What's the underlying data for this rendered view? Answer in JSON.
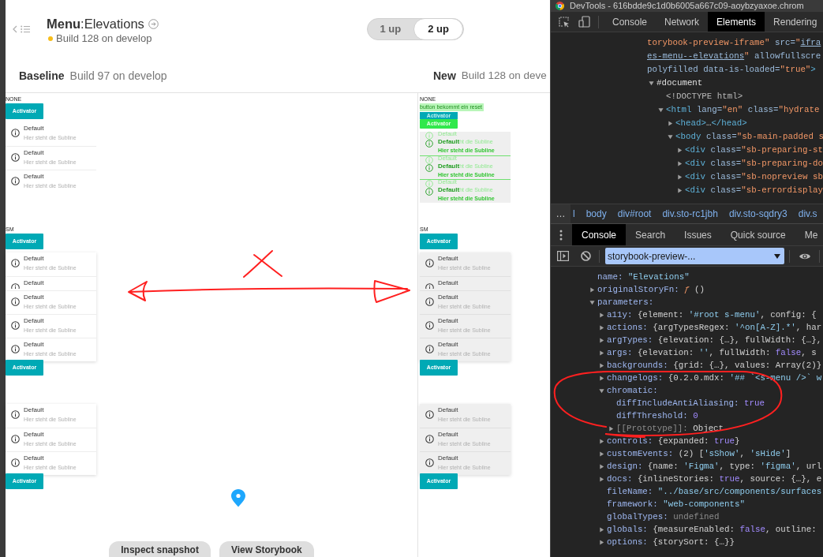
{
  "app": {
    "header": {
      "title": "**Menu**:Elevations",
      "build": "Build 128 on develop"
    },
    "view_toggle": [
      {
        "label": "1 up",
        "selected": false
      },
      {
        "label": "2 up",
        "selected": true
      }
    ],
    "panels": [
      {
        "label": "Baseline",
        "build": "Build 97 on develop",
        "stories": [
          {
            "label": "NONE",
            "blocks": [
              {
                "kind": "activator",
                "text": "Activator",
                "diff": false
              },
              {
                "kind": "menu",
                "raised": false,
                "filled": false,
                "items": [
                  {
                    "title": "Default",
                    "subline": "Hier steht die Subline",
                    "overlapped": false,
                    "diff": false
                  },
                  {
                    "title": "Default",
                    "subline": "Hier steht die Subline",
                    "overlapped": false,
                    "diff": false
                  },
                  {
                    "title": "Default",
                    "subline": "Hier steht die Subline",
                    "overlapped": false,
                    "diff": false
                  }
                ]
              }
            ]
          },
          {
            "label": "SM",
            "blocks": [
              {
                "kind": "activator",
                "text": "Activator",
                "diff": false
              },
              {
                "kind": "menu",
                "raised": true,
                "filled": false,
                "items": [
                  {
                    "title": "Default",
                    "subline": "Hier steht die Subline",
                    "overlapped": false,
                    "diff": false
                  },
                  {
                    "title": "Default",
                    "overlapped": true,
                    "diff": false
                  },
                  {
                    "title": "Default",
                    "subline": "Hier steht die Subline",
                    "overlapped": false,
                    "diff": false
                  },
                  {
                    "title": "Default",
                    "subline": "Hier steht die Subline",
                    "overlapped": false,
                    "diff": false
                  },
                  {
                    "title": "Default",
                    "subline": "Hier steht die Subline",
                    "overlapped": false,
                    "diff": false
                  }
                ]
              },
              {
                "kind": "activator",
                "text": "Activator",
                "diff": false
              }
            ]
          },
          {
            "blocks": [
              {
                "kind": "menu",
                "raised": true,
                "filled": false,
                "items": [
                  {
                    "title": "Default",
                    "subline": "Hier steht die Subline",
                    "overlapped": false,
                    "diff": false
                  },
                  {
                    "title": "Default",
                    "subline": "Hier steht die Subline",
                    "overlapped": false,
                    "diff": false
                  },
                  {
                    "title": "Default",
                    "subline": "Hier steht die Subline",
                    "overlapped": false,
                    "diff": false
                  }
                ]
              },
              {
                "kind": "activator",
                "text": "Activator",
                "diff": false
              }
            ]
          }
        ]
      },
      {
        "label": "New",
        "build": "Build 128 on deve",
        "stories": [
          {
            "label": "NONE",
            "blocks": [
              {
                "kind": "note",
                "text": "button bekommt ein reset"
              },
              {
                "kind": "activator",
                "text": "Activator",
                "diff": true,
                "ghost_text": "Activator"
              },
              {
                "kind": "menu",
                "raised": false,
                "filled": true,
                "items": [
                  {
                    "title": "Default",
                    "subline": "Hier steht die Subline",
                    "overlapped": false,
                    "diff": true,
                    "ghost_title": "Default",
                    "ghost_subline": "ht die Subline"
                  },
                  {
                    "title": "Default",
                    "subline": "Hier steht die Subline",
                    "overlapped": false,
                    "diff": true,
                    "ghost_title": "Default",
                    "ghost_subline": "ht die Subline"
                  },
                  {
                    "title": "Default",
                    "subline": "Hier steht die Subline",
                    "overlapped": false,
                    "diff": true,
                    "ghost_title": "Default",
                    "ghost_subline": "ht die Subline"
                  }
                ]
              }
            ]
          },
          {
            "label": "SM",
            "blocks": [
              {
                "kind": "activator",
                "text": "Activator",
                "diff": false
              },
              {
                "kind": "menu",
                "raised": true,
                "filled": true,
                "items": [
                  {
                    "title": "Default",
                    "subline": "Hier steht die Subline",
                    "overlapped": false,
                    "diff": false
                  },
                  {
                    "title": "Default",
                    "overlapped": true,
                    "diff": false
                  },
                  {
                    "title": "Default",
                    "subline": "Hier steht die Subline",
                    "overlapped": false,
                    "diff": false
                  },
                  {
                    "title": "Default",
                    "subline": "Hier steht die Subline",
                    "overlapped": false,
                    "diff": false
                  },
                  {
                    "title": "Default",
                    "subline": "Hier steht die Subline",
                    "overlapped": false,
                    "diff": false
                  }
                ]
              },
              {
                "kind": "activator",
                "text": "Activator",
                "diff": false
              }
            ]
          },
          {
            "blocks": [
              {
                "kind": "menu",
                "raised": true,
                "filled": true,
                "items": [
                  {
                    "title": "Default",
                    "subline": "Hier steht die Subline",
                    "overlapped": false,
                    "diff": false
                  },
                  {
                    "title": "Default",
                    "subline": "Hier steht die Subline",
                    "overlapped": false,
                    "diff": false
                  },
                  {
                    "title": "Default",
                    "subline": "Hier steht die Subline",
                    "overlapped": false,
                    "diff": false
                  }
                ]
              },
              {
                "kind": "activator",
                "text": "Activator",
                "diff": false
              }
            ]
          }
        ]
      }
    ],
    "actions": [
      "Inspect snapshot",
      "View Storybook"
    ]
  },
  "devtools": {
    "title": "DevTools - 616bdde9c1d0b6005a667c09-aoybzyaxoe.chrom",
    "tabs": [
      {
        "label": "Console",
        "selected": false
      },
      {
        "label": "Network",
        "selected": false
      },
      {
        "label": "Elements",
        "selected": true
      },
      {
        "label": "Rendering",
        "selected": false
      }
    ],
    "elements_tree": [
      {
        "lines": [
          [
            {
              "kind": "value",
              "text": "torybook-preview-iframe\""
            },
            {
              "kind": "attr",
              "text": " src="
            },
            {
              "kind": "value",
              "text": "\""
            },
            {
              "kind": "link",
              "text": "ifra"
            }
          ],
          [
            {
              "kind": "link",
              "text": "es-menu--elevations"
            },
            {
              "kind": "value",
              "text": "\""
            },
            {
              "kind": "attr",
              "text": " allowfullscre"
            }
          ],
          [
            {
              "kind": "attr",
              "text": "polyfilled data-is-loaded="
            },
            {
              "kind": "value",
              "text": "\"true\""
            },
            {
              "kind": "tag",
              "text": ">"
            }
          ]
        ],
        "children": [
          {
            "expanded": true,
            "segments": [
              {
                "kind": "doc",
                "text": "#document"
              }
            ],
            "children": [
              {
                "segments": [
                  {
                    "kind": "doctype",
                    "text": "<!DOCTYPE html>"
                  }
                ]
              },
              {
                "expanded": true,
                "segments": [
                  {
                    "kind": "tag",
                    "text": "<html"
                  },
                  {
                    "kind": "attr",
                    "text": " lang="
                  },
                  {
                    "kind": "value",
                    "text": "\"en\""
                  },
                  {
                    "kind": "attr",
                    "text": " class="
                  },
                  {
                    "kind": "value",
                    "text": "\"hydrate"
                  }
                ],
                "children": [
                  {
                    "expanded": false,
                    "segments": [
                      {
                        "kind": "tag",
                        "text": "<head>"
                      },
                      {
                        "kind": "text",
                        "text": "…"
                      },
                      {
                        "kind": "tag",
                        "text": "</head>"
                      }
                    ]
                  },
                  {
                    "expanded": true,
                    "segments": [
                      {
                        "kind": "tag",
                        "text": "<body"
                      },
                      {
                        "kind": "attr",
                        "text": " class="
                      },
                      {
                        "kind": "value",
                        "text": "\"sb-main-padded s"
                      }
                    ],
                    "children": [
                      {
                        "expanded": false,
                        "segments": [
                          {
                            "kind": "tag",
                            "text": "<div"
                          },
                          {
                            "kind": "attr",
                            "text": " class="
                          },
                          {
                            "kind": "value",
                            "text": "\"sb-preparing-st"
                          }
                        ]
                      },
                      {
                        "expanded": false,
                        "segments": [
                          {
                            "kind": "tag",
                            "text": "<div"
                          },
                          {
                            "kind": "attr",
                            "text": " class="
                          },
                          {
                            "kind": "value",
                            "text": "\"sb-preparing-do"
                          }
                        ]
                      },
                      {
                        "expanded": false,
                        "segments": [
                          {
                            "kind": "tag",
                            "text": "<div"
                          },
                          {
                            "kind": "attr",
                            "text": " class="
                          },
                          {
                            "kind": "value",
                            "text": "\"sb-nopreview sb"
                          }
                        ]
                      },
                      {
                        "expanded": false,
                        "segments": [
                          {
                            "kind": "tag",
                            "text": "<div"
                          },
                          {
                            "kind": "attr",
                            "text": " class="
                          },
                          {
                            "kind": "value",
                            "text": "\"sb-errordisplay"
                          }
                        ]
                      }
                    ]
                  }
                ]
              }
            ]
          }
        ]
      }
    ],
    "breadcrumbs": {
      "overflow": "…",
      "items": [
        "l",
        "body",
        "div#root",
        "div.sto-rc1jbh",
        "div.sto-sqdry3",
        "div.s"
      ]
    },
    "drawer_tabs": [
      {
        "label": "Console",
        "selected": true
      },
      {
        "label": "Search",
        "selected": false
      },
      {
        "label": "Issues",
        "selected": false
      },
      {
        "label": "Quick source",
        "selected": false
      },
      {
        "label": "Me",
        "selected": false
      }
    ],
    "context": "storybook-preview-...",
    "console_tree": [
      {
        "segments": [
          {
            "kind": "key",
            "text": "name:"
          },
          {
            "kind": "str",
            "text": " \"Elevations\""
          }
        ]
      },
      {
        "expanded": false,
        "segments": [
          {
            "kind": "key",
            "text": "originalStoryFn:"
          },
          {
            "kind": "fn",
            "text": " ƒ"
          },
          {
            "kind": "plain",
            "text": " ()"
          }
        ]
      },
      {
        "expanded": true,
        "segments": [
          {
            "kind": "key",
            "text": "parameters:"
          }
        ],
        "children": [
          {
            "expanded": false,
            "segments": [
              {
                "kind": "key",
                "text": "a11y:"
              },
              {
                "kind": "plain",
                "text": " {element: "
              },
              {
                "kind": "str",
                "text": "'#root s-menu'"
              },
              {
                "kind": "plain",
                "text": ", config: {"
              }
            ]
          },
          {
            "expanded": false,
            "segments": [
              {
                "kind": "key",
                "text": "actions:"
              },
              {
                "kind": "plain",
                "text": " {argTypesRegex: "
              },
              {
                "kind": "str",
                "text": "'^on[A-Z].*'"
              },
              {
                "kind": "plain",
                "text": ", har"
              }
            ]
          },
          {
            "expanded": false,
            "segments": [
              {
                "kind": "key",
                "text": "argTypes:"
              },
              {
                "kind": "plain",
                "text": " {elevation: {…}, fullWidth: {…},"
              }
            ]
          },
          {
            "expanded": false,
            "segments": [
              {
                "kind": "key",
                "text": "args:"
              },
              {
                "kind": "plain",
                "text": " {elevation: "
              },
              {
                "kind": "str",
                "text": "''"
              },
              {
                "kind": "plain",
                "text": ", fullWidth: "
              },
              {
                "kind": "kw",
                "text": "false"
              },
              {
                "kind": "plain",
                "text": ", s"
              }
            ]
          },
          {
            "expanded": false,
            "segments": [
              {
                "kind": "key",
                "text": "backgrounds:"
              },
              {
                "kind": "plain",
                "text": " {grid: {…}, values: Array(2)}"
              }
            ]
          },
          {
            "expanded": false,
            "segments": [
              {
                "kind": "key",
                "text": "changelogs:"
              },
              {
                "kind": "plain",
                "text": " {0.2.0.mdx: "
              },
              {
                "kind": "str",
                "text": "'## `<s-menu />` w"
              }
            ]
          },
          {
            "expanded": true,
            "segments": [
              {
                "kind": "key",
                "text": "chromatic:"
              }
            ],
            "children": [
              {
                "segments": [
                  {
                    "kind": "key",
                    "text": "diffIncludeAntiAliasing:"
                  },
                  {
                    "kind": "kw",
                    "text": " true"
                  }
                ]
              },
              {
                "segments": [
                  {
                    "kind": "key",
                    "text": "diffThreshold:"
                  },
                  {
                    "kind": "kw",
                    "text": " 0"
                  }
                ]
              },
              {
                "expanded": false,
                "segments": [
                  {
                    "kind": "muted",
                    "text": "[[Prototype]]:"
                  },
                  {
                    "kind": "plain",
                    "text": " Object"
                  }
                ]
              }
            ]
          },
          {
            "expanded": false,
            "segments": [
              {
                "kind": "key",
                "text": "controls:"
              },
              {
                "kind": "plain",
                "text": " {expanded: "
              },
              {
                "kind": "kw",
                "text": "true"
              },
              {
                "kind": "plain",
                "text": "}"
              }
            ]
          },
          {
            "expanded": false,
            "segments": [
              {
                "kind": "key",
                "text": "customEvents:"
              },
              {
                "kind": "plain",
                "text": " (2) ["
              },
              {
                "kind": "str",
                "text": "'sShow'"
              },
              {
                "kind": "plain",
                "text": ", "
              },
              {
                "kind": "str",
                "text": "'sHide'"
              },
              {
                "kind": "plain",
                "text": "]"
              }
            ]
          },
          {
            "expanded": false,
            "segments": [
              {
                "kind": "key",
                "text": "design:"
              },
              {
                "kind": "plain",
                "text": " {name: "
              },
              {
                "kind": "str",
                "text": "'Figma'"
              },
              {
                "kind": "plain",
                "text": ", type: "
              },
              {
                "kind": "str",
                "text": "'figma'"
              },
              {
                "kind": "plain",
                "text": ", url"
              }
            ]
          },
          {
            "expanded": false,
            "segments": [
              {
                "kind": "key",
                "text": "docs:"
              },
              {
                "kind": "plain",
                "text": " {inlineStories: "
              },
              {
                "kind": "kw",
                "text": "true"
              },
              {
                "kind": "plain",
                "text": ", source: {…}, e"
              }
            ]
          },
          {
            "segments": [
              {
                "kind": "key",
                "text": "fileName:"
              },
              {
                "kind": "str",
                "text": " \"../base/src/components/surfaces"
              }
            ]
          },
          {
            "segments": [
              {
                "kind": "key",
                "text": "framework:"
              },
              {
                "kind": "str",
                "text": " \"web-components\""
              }
            ]
          },
          {
            "segments": [
              {
                "kind": "key",
                "text": "globalTypes:"
              },
              {
                "kind": "muted",
                "text": " undefined"
              }
            ]
          },
          {
            "expanded": false,
            "segments": [
              {
                "kind": "key",
                "text": "globals:"
              },
              {
                "kind": "plain",
                "text": " {measureEnabled: "
              },
              {
                "kind": "kw",
                "text": "false"
              },
              {
                "kind": "plain",
                "text": ", outline:"
              }
            ]
          },
          {
            "expanded": false,
            "segments": [
              {
                "kind": "key",
                "text": "options:"
              },
              {
                "kind": "plain",
                "text": " {storySort: {…}}"
              }
            ]
          }
        ]
      }
    ]
  }
}
